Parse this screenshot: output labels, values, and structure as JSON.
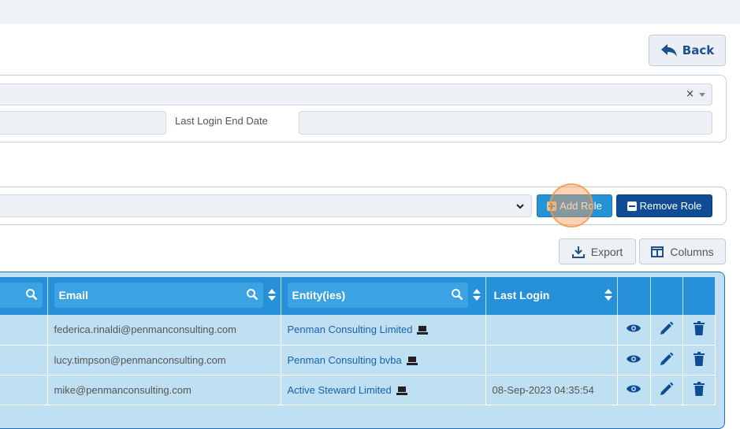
{
  "header": {
    "back_label": "Back"
  },
  "filters": {
    "select_clear": "×",
    "last_login_end_label": "Last Login End Date"
  },
  "roles": {
    "add_label": "Add Role",
    "remove_label": "Remove Role"
  },
  "toolbar": {
    "export_label": "Export",
    "columns_label": "Columns"
  },
  "table": {
    "columns": [
      "Email",
      "Entity(ies)",
      "Last Login"
    ],
    "rows": [
      {
        "email": "federica.rinaldi@penmanconsulting.com",
        "entity": "Penman Consulting Limited",
        "last_login": ""
      },
      {
        "email": "lucy.timpson@penmanconsulting.com",
        "entity": "Penman Consulting bvba",
        "last_login": ""
      },
      {
        "email": "mike@penmanconsulting.com",
        "entity": "Active Steward Limited",
        "last_login": "08-Sep-2023 04:35:54"
      }
    ]
  },
  "colors": {
    "header_blue": "#2690d8",
    "row_bg": "#bfe0f3",
    "link": "#1b5fae",
    "icon": "#0f4c94",
    "add_role_bg": "#2593d7",
    "remove_role_bg": "#0f4c94"
  },
  "icons": [
    "back-arrow-icon",
    "search-icon",
    "sort-icon",
    "laptop-icon",
    "eye-icon",
    "pencil-icon",
    "trash-icon",
    "download-icon",
    "columns-icon",
    "plus-square-icon",
    "minus-square-icon"
  ]
}
